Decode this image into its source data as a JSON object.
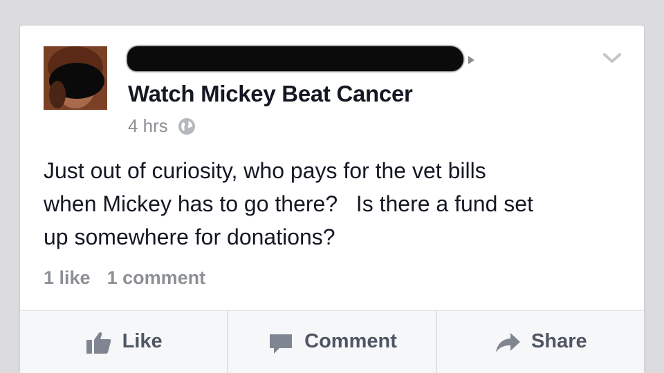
{
  "post": {
    "author_redacted": "",
    "page_name": "Watch Mickey Beat Cancer",
    "time": "4 hrs",
    "privacy_icon": "globe-icon",
    "body": "Just out of curiosity, who pays for the vet bills\nwhen Mickey has to go there?   Is there a fund set\nup somewhere for donations?"
  },
  "stats": {
    "likes": "1 like",
    "comments": "1 comment"
  },
  "actions": {
    "like_label": "Like",
    "comment_label": "Comment",
    "share_label": "Share"
  },
  "colors": {
    "background": "#dcdcde",
    "card": "#ffffff",
    "text": "#141823",
    "muted": "#8c8f94",
    "action_text": "#4e5665"
  }
}
